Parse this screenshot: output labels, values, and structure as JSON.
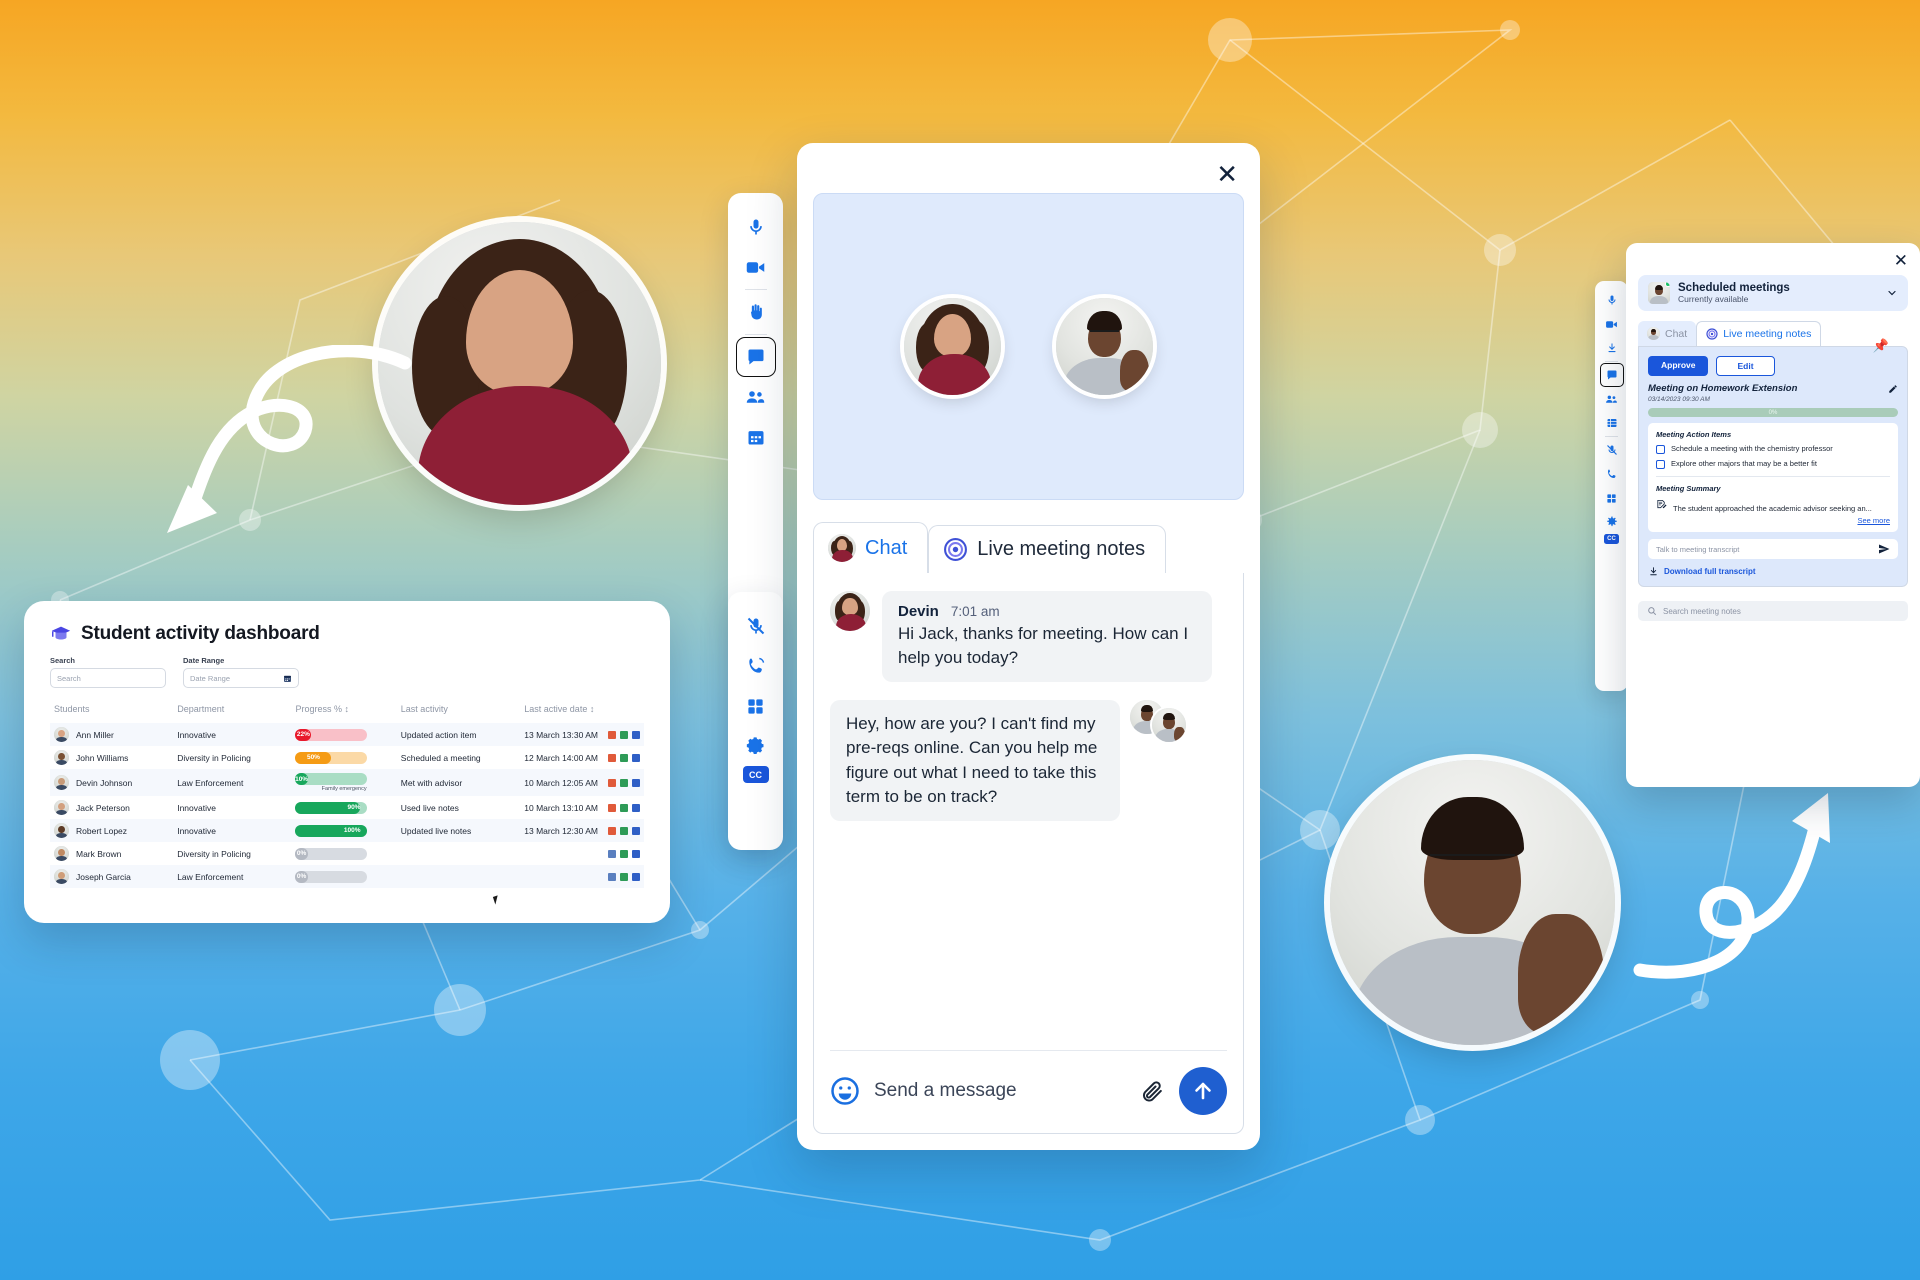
{
  "background": {
    "gradient_top": "#f6a623",
    "gradient_bottom": "#2f9fe6"
  },
  "dashboard": {
    "title": "Student activity dashboard",
    "icon": "graduation-cap-icon",
    "filters": [
      {
        "label": "Search",
        "placeholder": "Search",
        "icon": null
      },
      {
        "label": "Date Range",
        "placeholder": "Date Range",
        "icon": "calendar-icon"
      }
    ],
    "columns": [
      "Students",
      "Department",
      "Progress %",
      "Last activity",
      "Last active date"
    ],
    "sortable_columns": [
      "Progress %",
      "Last active date"
    ],
    "rows": [
      {
        "student": "Ann Miller",
        "department": "Innovative",
        "progress": 22,
        "progress_label": "22%",
        "color": "#e8192c",
        "track": "#f9c0c8",
        "note": "",
        "activity": "Updated action item",
        "date": "13 March 13:30 AM"
      },
      {
        "student": "John Williams",
        "department": "Diversity in Policing",
        "progress": 50,
        "progress_label": "50%",
        "color": "#f59b14",
        "track": "#fbd9a6",
        "note": "",
        "activity": "Scheduled a meeting",
        "date": "12 March 14:00 AM"
      },
      {
        "student": "Devin Johnson",
        "department": "Law Enforcement",
        "progress": 10,
        "progress_label": "10%",
        "color": "#17a75c",
        "track": "#a9ddc4",
        "note": "Family emergency",
        "activity": "Met with advisor",
        "date": "10 March 12:05 AM"
      },
      {
        "student": "Jack Peterson",
        "department": "Innovative",
        "progress": 90,
        "progress_label": "90%",
        "color": "#17a75c",
        "track": "#a9ddc4",
        "note": "",
        "activity": "Used live notes",
        "date": "10 March 13:10 AM"
      },
      {
        "student": "Robert Lopez",
        "department": "Innovative",
        "progress": 100,
        "progress_label": "100%",
        "color": "#17a75c",
        "track": "#a9ddc4",
        "note": "",
        "activity": "Updated live notes",
        "date": "13 March 12:30 AM"
      },
      {
        "student": "Mark Brown",
        "department": "Diversity in Policing",
        "progress": 0,
        "progress_label": "0%",
        "color": "#b4b9c2",
        "track": "#d7dbe1",
        "note": "",
        "activity": "",
        "date": ""
      },
      {
        "student": "Joseph Garcia",
        "department": "Law Enforcement",
        "progress": 0,
        "progress_label": "0%",
        "color": "#b4b9c2",
        "track": "#d7dbe1",
        "note": "",
        "activity": "",
        "date": ""
      }
    ],
    "row_actions": [
      "chart-icon",
      "grid-icon",
      "calendar-icon"
    ]
  },
  "meeting_window": {
    "close_label": "✕",
    "left_rail": [
      "microphone-icon",
      "video-camera-icon",
      "divider",
      "raise-hand-icon",
      "divider",
      "chat-icon",
      "people-icon",
      "calendar-icon"
    ],
    "left_rail_2": [
      "microphone-muted-icon",
      "phone-ring-icon",
      "apps-grid-icon",
      "gear-icon",
      "cc-chip"
    ],
    "cc_label": "CC",
    "tabs": [
      {
        "label": "Chat",
        "active": true,
        "icon": "avatar-woman"
      },
      {
        "label": "Live meeting notes",
        "active": false,
        "icon": "spiral-icon"
      }
    ],
    "messages": [
      {
        "direction": "incoming",
        "sender": "Devin",
        "time": "7:01 am",
        "text": "Hi Jack, thanks for meeting. How can I help you today?"
      },
      {
        "direction": "outgoing",
        "sender": "",
        "time": "",
        "text": "Hey, how are you? I can't find my pre-reqs online. Can you help me figure out what I need to take this term to be on track?"
      }
    ],
    "composer": {
      "emoji_icon": "smiley-icon",
      "placeholder": "Send a message",
      "attach_icon": "paperclip-icon",
      "send_icon": "arrow-up-icon"
    }
  },
  "notes_panel": {
    "close_label": "✕",
    "scheduled": {
      "title": "Scheduled meetings",
      "subtitle": "Currently available",
      "chevron": "chevron-down-icon",
      "status_color": "#19c167"
    },
    "tabs": [
      {
        "label": "Chat",
        "active": false
      },
      {
        "label": "Live meeting notes",
        "active": true
      }
    ],
    "pin_icon": "pushpin-icon",
    "approve_label": "Approve",
    "edit_label": "Edit",
    "note_title": "Meeting on Homework Extension",
    "note_date": "03/14/2023 09:30 AM",
    "edit_pencil_icon": "pencil-icon",
    "progress_label": "0%",
    "action_items_heading": "Meeting Action Items",
    "action_items": [
      "Schedule a meeting with the chemistry professor",
      "Explore other majors that may be a better fit"
    ],
    "summary_heading": "Meeting Summary",
    "summary_text": "The student approached the academic advisor seeking an...",
    "see_more_label": "See more",
    "transcript_placeholder": "Talk to meeting transcript",
    "transcript_send_icon": "send-icon",
    "download_label": "Download full transcript",
    "download_icon": "download-icon",
    "search_placeholder": "Search meeting notes",
    "search_icon": "search-icon",
    "right_rail": [
      "microphone-icon",
      "video-camera-icon",
      "download-icon",
      "divider",
      "chat-icon",
      "people-icon",
      "grid-icon",
      "divider",
      "microphone-muted-icon",
      "phone-ring-icon",
      "apps-grid-icon",
      "gear-icon",
      "cc-chip"
    ],
    "cc_label": "CC"
  },
  "people": {
    "woman": "woman-portrait",
    "man": "man-portrait-waving"
  }
}
